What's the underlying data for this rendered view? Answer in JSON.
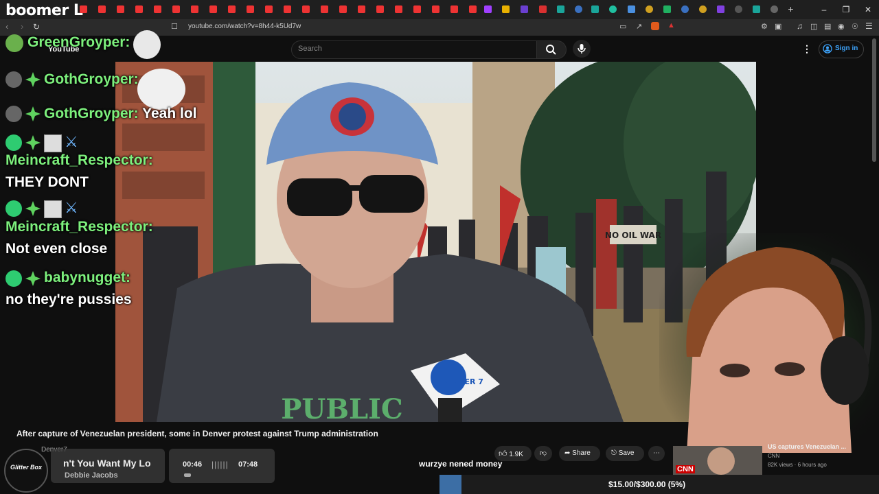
{
  "browser": {
    "brand_text": "boomer L",
    "url": "youtube.com/watch?v=8h44-k5Ud7w",
    "window_controls": [
      "minimize-icon",
      "restore-icon",
      "close-icon"
    ]
  },
  "youtube": {
    "logo_text": "YouTube",
    "search_placeholder": "Search",
    "sign_in_label": "Sign in"
  },
  "chat": {
    "messages": [
      {
        "user": "GreenGroyper:",
        "text": ""
      },
      {
        "user": "GothGroyper:",
        "text": ""
      },
      {
        "user": "GothGroyper:",
        "text": "Yeah lol"
      },
      {
        "user": "Meincraft_Respector:",
        "text": "THEY DONT"
      },
      {
        "user": "Meincraft_Respector:",
        "text": "Not even close"
      },
      {
        "user": "babynugget:",
        "text": "no they're pussies"
      }
    ]
  },
  "video": {
    "sign_text": "NO OIL WAR",
    "mic_flag_text": "DENVER 7",
    "shirt_text": "PUBLIC"
  },
  "video_info": {
    "title": "After capture of Venezuelan president, some in Denver protest against Trump administration",
    "channel": "Denver7",
    "like_count": "1.9K",
    "share_label": "Share",
    "save_label": "Save"
  },
  "recommendation": {
    "title": "US captures Venezuelan ...",
    "channel": "CNN",
    "meta": "82K views · 6 hours ago",
    "thumb_text": "CNN"
  },
  "music": {
    "art_label": "Glitter Box",
    "song": "n't You Want My Lo",
    "artist": "Debbie Jacobs",
    "elapsed": "00:46",
    "total": "07:48"
  },
  "caption": "wurzye nened money",
  "donation": {
    "text": "$15.00/$300.00 (5%)",
    "progress": 0.05
  }
}
